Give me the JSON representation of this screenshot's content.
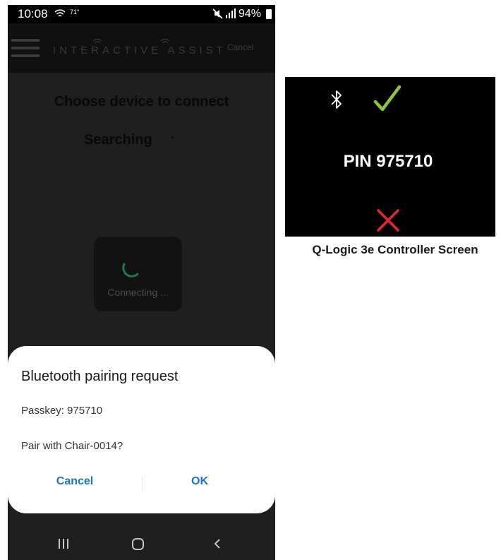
{
  "status_bar": {
    "time": "10:08",
    "temperature": "71°",
    "battery": "94%",
    "icons": [
      "wifi-icon",
      "mute-icon",
      "lte-signal-icon",
      "battery-icon"
    ]
  },
  "app_bar": {
    "logo": "INTERACTIVE ASSIST",
    "cancel_label": "Cancel",
    "menu_icon": "hamburger-menu-icon"
  },
  "main": {
    "title": "Choose device to connect",
    "searching": "Searching",
    "connecting": "Connecting ..."
  },
  "dialog": {
    "title": "Bluetooth pairing request",
    "passkey": "Passkey: 975710",
    "pair_prompt": "Pair with Chair-0014?",
    "cancel_label": "Cancel",
    "ok_label": "OK",
    "accent_color": "#1775c6"
  },
  "nav_bar": {
    "icons": [
      "recent-apps-icon",
      "home-icon",
      "back-icon"
    ]
  },
  "controller": {
    "pin": "PIN 975710",
    "caption": "Q-Logic 3e Controller Screen",
    "icons": [
      "bluetooth-icon",
      "check-icon",
      "x-icon"
    ],
    "check_color": "#8cc63f",
    "x_color": "#e8262a"
  }
}
